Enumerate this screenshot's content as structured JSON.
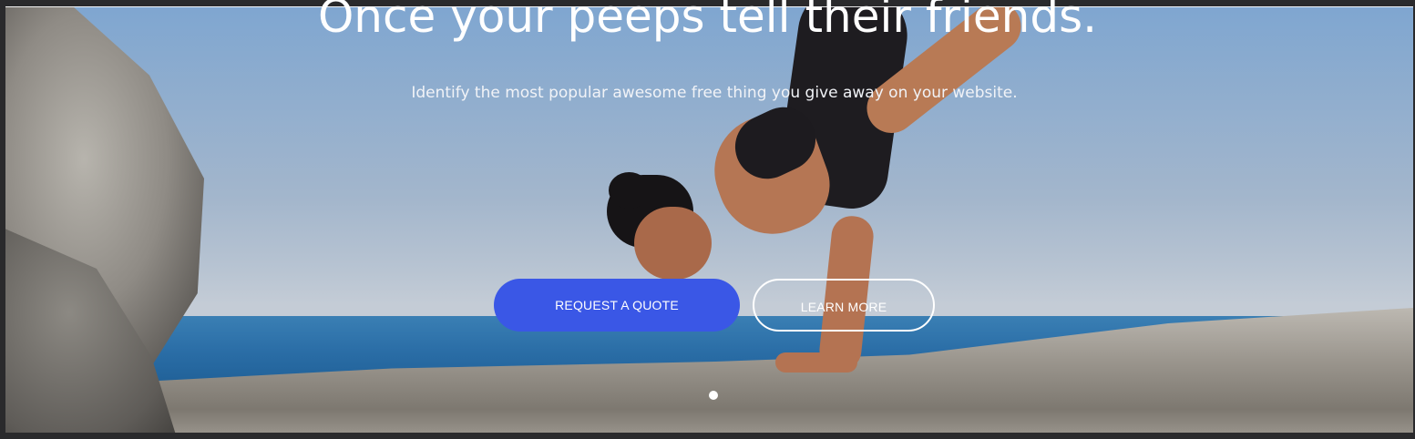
{
  "hero": {
    "title": "Once your peeps tell their friends.",
    "subtitle": "Identify the most popular awesome free thing you give away on your website.",
    "primary_button": "REQUEST A QUOTE",
    "secondary_button": "LEARN MORE"
  },
  "colors": {
    "primary_button_bg": "#3a57e6",
    "text": "#ffffff"
  },
  "carousel": {
    "dots": 1,
    "active_index": 1
  }
}
